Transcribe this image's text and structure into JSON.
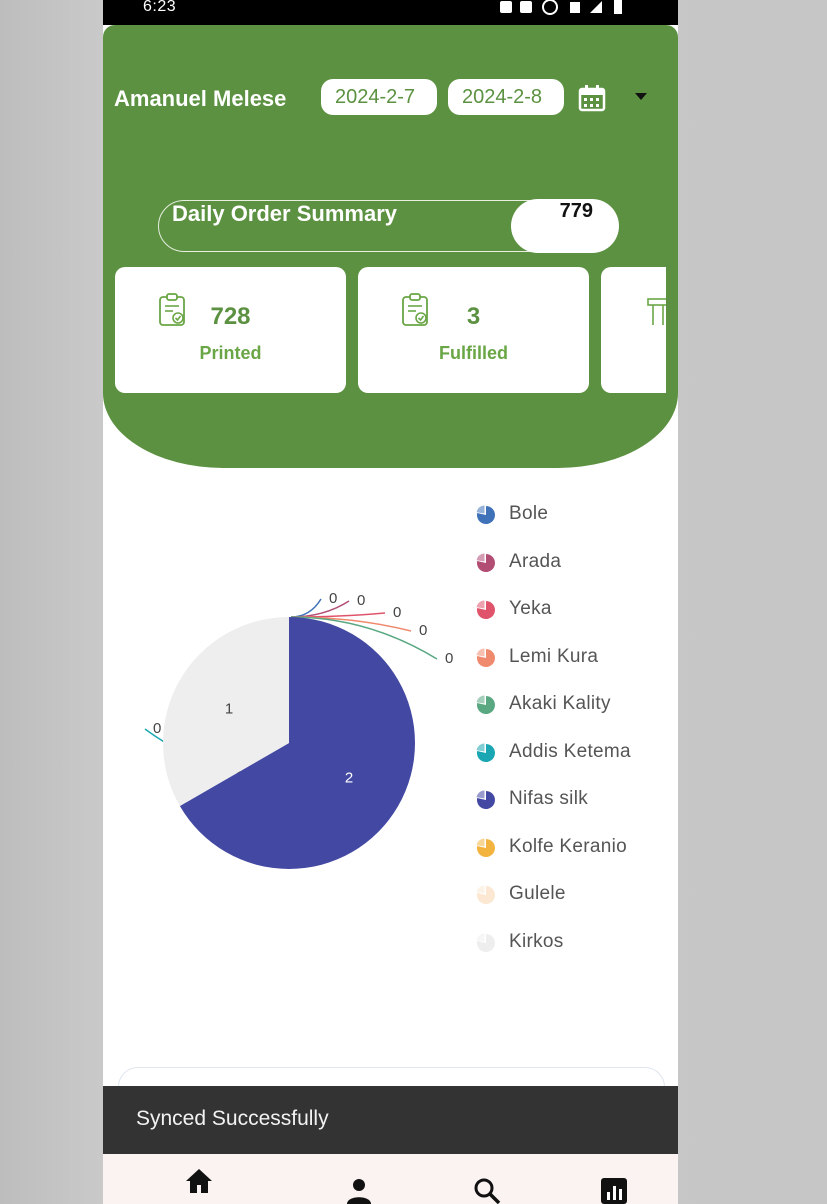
{
  "status_bar": {
    "time": "6:23"
  },
  "header": {
    "user_name": "Amanuel Melese",
    "date_from": "2024-2-7",
    "date_to": "2024-2-8",
    "summary_label": "Daily Order Summary",
    "summary_count": "779"
  },
  "cards": [
    {
      "value": "728",
      "label": "Printed",
      "icon": "clipboard-check-icon"
    },
    {
      "value": "3",
      "label": "Fulfilled",
      "icon": "clipboard-check-icon"
    }
  ],
  "chart_data": {
    "type": "pie",
    "categories": [
      "Bole",
      "Arada",
      "Yeka",
      "Lemi Kura",
      "Akaki Kality",
      "Addis Ketema",
      "Nifas silk",
      "Kolfe Keranio",
      "Gulele",
      "Kirkos"
    ],
    "values": [
      0,
      0,
      0,
      0,
      0,
      0,
      2,
      0,
      0,
      1
    ],
    "data_labels": [
      "0",
      "0",
      "0",
      "0",
      "0",
      "0",
      "2",
      "0",
      "0",
      "1"
    ],
    "colors": [
      "#3f72b8",
      "#b24d74",
      "#e0546b",
      "#f08a6e",
      "#59a882",
      "#1aa7b3",
      "#4349a3",
      "#f2b43f",
      "#fbe7d2",
      "#eeeeee"
    ]
  },
  "snackbar": {
    "message": "Synced Successfully"
  },
  "bottom_nav": [
    "home-icon",
    "person-icon",
    "search-icon",
    "chart-icon"
  ]
}
